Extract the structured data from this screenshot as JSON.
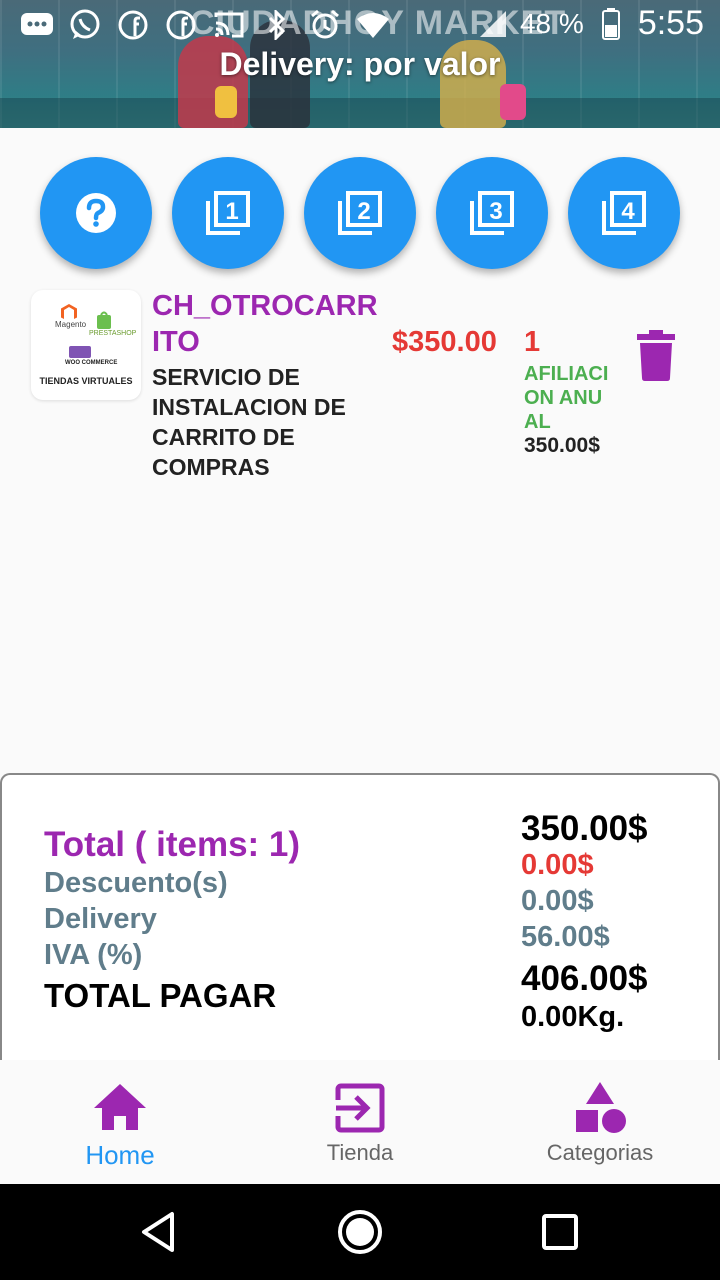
{
  "status_bar": {
    "battery": "48 %",
    "time": "5:55",
    "icons": [
      "chat-icon",
      "whatsapp-icon",
      "facebook-icon",
      "facebook-icon",
      "cast-icon",
      "bluetooth-icon",
      "alarm-icon",
      "wifi-icon",
      "battery-icon"
    ]
  },
  "header": {
    "brand": "CIUDADHOY MARKET",
    "title": "Delivery: por valor"
  },
  "action_buttons": [
    {
      "icon": "help-icon"
    },
    {
      "icon": "filter-1-icon",
      "number": "1"
    },
    {
      "icon": "filter-2-icon",
      "number": "2"
    },
    {
      "icon": "filter-3-icon",
      "number": "3"
    },
    {
      "icon": "filter-4-icon",
      "number": "4"
    }
  ],
  "cart_item": {
    "thumbnail_text": {
      "magento": "Magento",
      "prestashop": "PRESTASHOP",
      "woo": "WOO COMMERCE",
      "caption": "TIENDAS VIRTUALES"
    },
    "code": "CH_OTROCARRITO",
    "description": "SERVICIO DE INSTALACION DE CARRITO DE COMPRAS",
    "price": "$350.00",
    "quantity": "1",
    "plan": "AFILIACION ANUAL",
    "plan_price": "350.00$"
  },
  "totals": {
    "total_label": "Total ( items: 1)",
    "discount_label": "Descuento(s)",
    "delivery_label": "Delivery",
    "iva_label": "IVA (%)",
    "grand_label": "TOTAL PAGAR",
    "total_value": "350.00$",
    "discount_value": "0.00$",
    "delivery_value": "0.00$",
    "iva_value": "56.00$",
    "grand_value": "406.00$",
    "weight_value": "0.00Kg."
  },
  "bottom_nav": [
    {
      "label": "Home",
      "icon": "home-icon",
      "active": true
    },
    {
      "label": "Tienda",
      "icon": "login-icon",
      "active": false
    },
    {
      "label": "Categorias",
      "icon": "category-icon",
      "active": false
    }
  ],
  "colors": {
    "primary_blue": "#2196f3",
    "purple": "#9c27b0",
    "red": "#e53935",
    "green": "#4caf50",
    "slate": "#607d8b"
  }
}
